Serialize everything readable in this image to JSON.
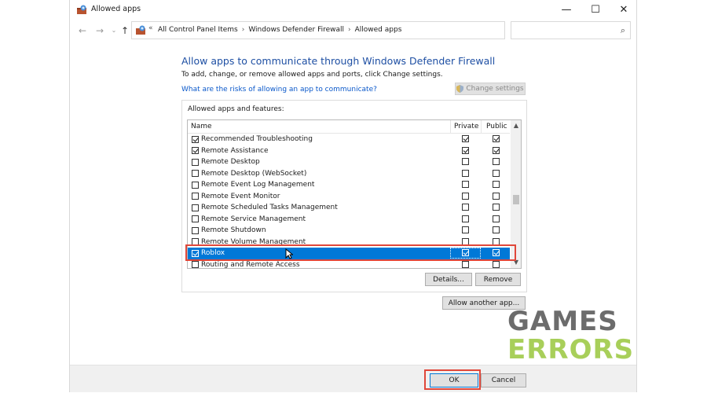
{
  "window": {
    "title": "Allowed apps",
    "controls": {
      "minimize": "—",
      "maximize": "☐",
      "close": "✕"
    }
  },
  "address": {
    "chevron": "«",
    "crumbs": [
      "All Control Panel Items",
      "Windows Defender Firewall",
      "Allowed apps"
    ],
    "separator": "›",
    "dropdown": "⌄",
    "refresh": "↻",
    "search_placeholder": ""
  },
  "main": {
    "heading": "Allow apps to communicate through Windows Defender Firewall",
    "subtext": "To add, change, or remove allowed apps and ports, click Change settings.",
    "risk_link": "What are the risks of allowing an app to communicate?",
    "change_settings_label": "Change settings",
    "group_label": "Allowed apps and features:",
    "columns": {
      "name": "Name",
      "private": "Private",
      "public": "Public"
    },
    "rows": [
      {
        "name": "Recommended Troubleshooting",
        "checked": true,
        "private": true,
        "public": true,
        "selected": false
      },
      {
        "name": "Remote Assistance",
        "checked": true,
        "private": true,
        "public": true,
        "selected": false
      },
      {
        "name": "Remote Desktop",
        "checked": false,
        "private": false,
        "public": false,
        "selected": false
      },
      {
        "name": "Remote Desktop (WebSocket)",
        "checked": false,
        "private": false,
        "public": false,
        "selected": false
      },
      {
        "name": "Remote Event Log Management",
        "checked": false,
        "private": false,
        "public": false,
        "selected": false
      },
      {
        "name": "Remote Event Monitor",
        "checked": false,
        "private": false,
        "public": false,
        "selected": false
      },
      {
        "name": "Remote Scheduled Tasks Management",
        "checked": false,
        "private": false,
        "public": false,
        "selected": false
      },
      {
        "name": "Remote Service Management",
        "checked": false,
        "private": false,
        "public": false,
        "selected": false
      },
      {
        "name": "Remote Shutdown",
        "checked": false,
        "private": false,
        "public": false,
        "selected": false
      },
      {
        "name": "Remote Volume Management",
        "checked": false,
        "private": false,
        "public": false,
        "selected": false
      },
      {
        "name": "Roblox",
        "checked": true,
        "private": true,
        "public": true,
        "selected": true
      },
      {
        "name": "Routing and Remote Access",
        "checked": false,
        "private": false,
        "public": false,
        "selected": false
      }
    ],
    "details_label": "Details...",
    "remove_label": "Remove",
    "allow_another_label": "Allow another app..."
  },
  "footer": {
    "ok_label": "OK",
    "cancel_label": "Cancel"
  },
  "watermark": {
    "line1": "GAMES",
    "line2": "ERRORS"
  },
  "colors": {
    "heading": "#1e4fa3",
    "selection": "#0078d7",
    "highlight": "#e0473a",
    "brand_gray": "#6c6c6c",
    "brand_green": "#a8cf5a"
  }
}
